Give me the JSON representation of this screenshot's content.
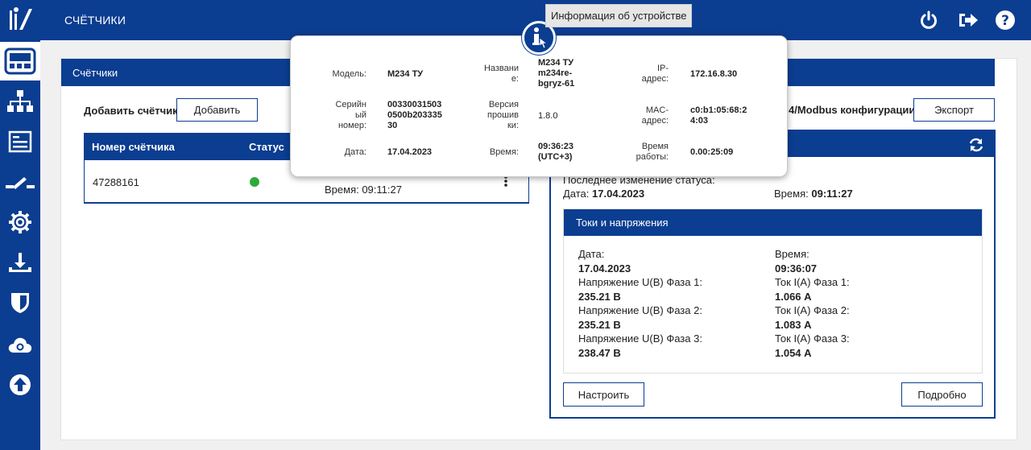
{
  "app": {
    "title": "СЧЁТЧИКИ"
  },
  "sidebar": {
    "items": [
      {
        "icon": "meter-icon",
        "active": true
      },
      {
        "icon": "network-icon",
        "active": false
      },
      {
        "icon": "document-list-icon",
        "active": false
      },
      {
        "icon": "switch-icon",
        "active": false
      },
      {
        "icon": "gear-icon",
        "active": false
      },
      {
        "icon": "upload-tray-icon",
        "active": false
      },
      {
        "icon": "shield-icon",
        "active": false
      },
      {
        "icon": "cloud-gear-icon",
        "active": false
      },
      {
        "icon": "arrow-up-circle-icon",
        "active": false
      }
    ]
  },
  "topbar_icons": [
    "power-icon",
    "logout-icon",
    "help-icon"
  ],
  "meters_panel": {
    "title": "Счётчики",
    "add_label": "Добавить счётчик",
    "add_button": "Добавить",
    "columns": [
      "Номер счётчика",
      "Статус"
    ],
    "rows": [
      {
        "number": "47288161",
        "status_color": "#2eaa3d",
        "time_text": "Время: 09:11:27"
      }
    ]
  },
  "config": {
    "title_partial": "4/Modbus конфигурации",
    "export_button": "Экспорт"
  },
  "status_card": {
    "last_change": "Последнее изменение статуса:",
    "date_label": "Дата:",
    "date_value": "17.04.2023",
    "time_label": "Время:",
    "time_value": "09:11:27"
  },
  "measurements": {
    "title": "Токи и напряжения",
    "date_label": "Дата:",
    "date_value": "17.04.2023",
    "time_label": "Время:",
    "time_value": "09:36:07",
    "voltages": [
      {
        "label": "Напряжение U(В) Фаза 1:",
        "value": "235.21 В"
      },
      {
        "label": "Напряжение U(В) Фаза 2:",
        "value": "235.21 В"
      },
      {
        "label": "Напряжение U(В) Фаза 3:",
        "value": "238.47 В"
      }
    ],
    "currents": [
      {
        "label": "Ток I(A) Фаза 1:",
        "value": "1.066 А"
      },
      {
        "label": "Ток I(A) Фаза 2:",
        "value": "1.083 А"
      },
      {
        "label": "Ток I(A) Фаза 3:",
        "value": "1.054 А"
      }
    ],
    "configure_button": "Настроить",
    "details_button": "Подробно"
  },
  "device_info": {
    "tooltip": "Информация об устройстве",
    "model_label": "Модель:",
    "model_value": "М234 ТУ",
    "name_label_1": "Названи",
    "name_label_2": "е:",
    "name_value_1": "М234 ТУ",
    "name_value_2": "m234re-",
    "name_value_3": "bgryz-61",
    "ip_label_1": "IP-",
    "ip_label_2": "адрес:",
    "ip_value": "172.16.8.30",
    "serial_label_1": "Серийн",
    "serial_label_2": "ый",
    "serial_label_3": "номер:",
    "serial_value_1": "00330031503",
    "serial_value_2": "0500b203335",
    "serial_value_3": "30",
    "fw_label_1": "Версия",
    "fw_label_2": "прошив",
    "fw_label_3": "ки:",
    "fw_value": "1.8.0",
    "mac_label_1": "MAC-",
    "mac_label_2": "адрес:",
    "mac_value_1": "c0:b1:05:68:2",
    "mac_value_2": "4:03",
    "date_label": "Дата:",
    "date_value": "17.04.2023",
    "time_label": "Время:",
    "time_value_1": "09:36:23",
    "time_value_2": "(UTC+3)",
    "uptime_label_1": "Время",
    "uptime_label_2": "работы:",
    "uptime_value": "0.00:25:09"
  },
  "colors": {
    "brand": "#0b3d91",
    "status_ok": "#2eaa3d"
  }
}
